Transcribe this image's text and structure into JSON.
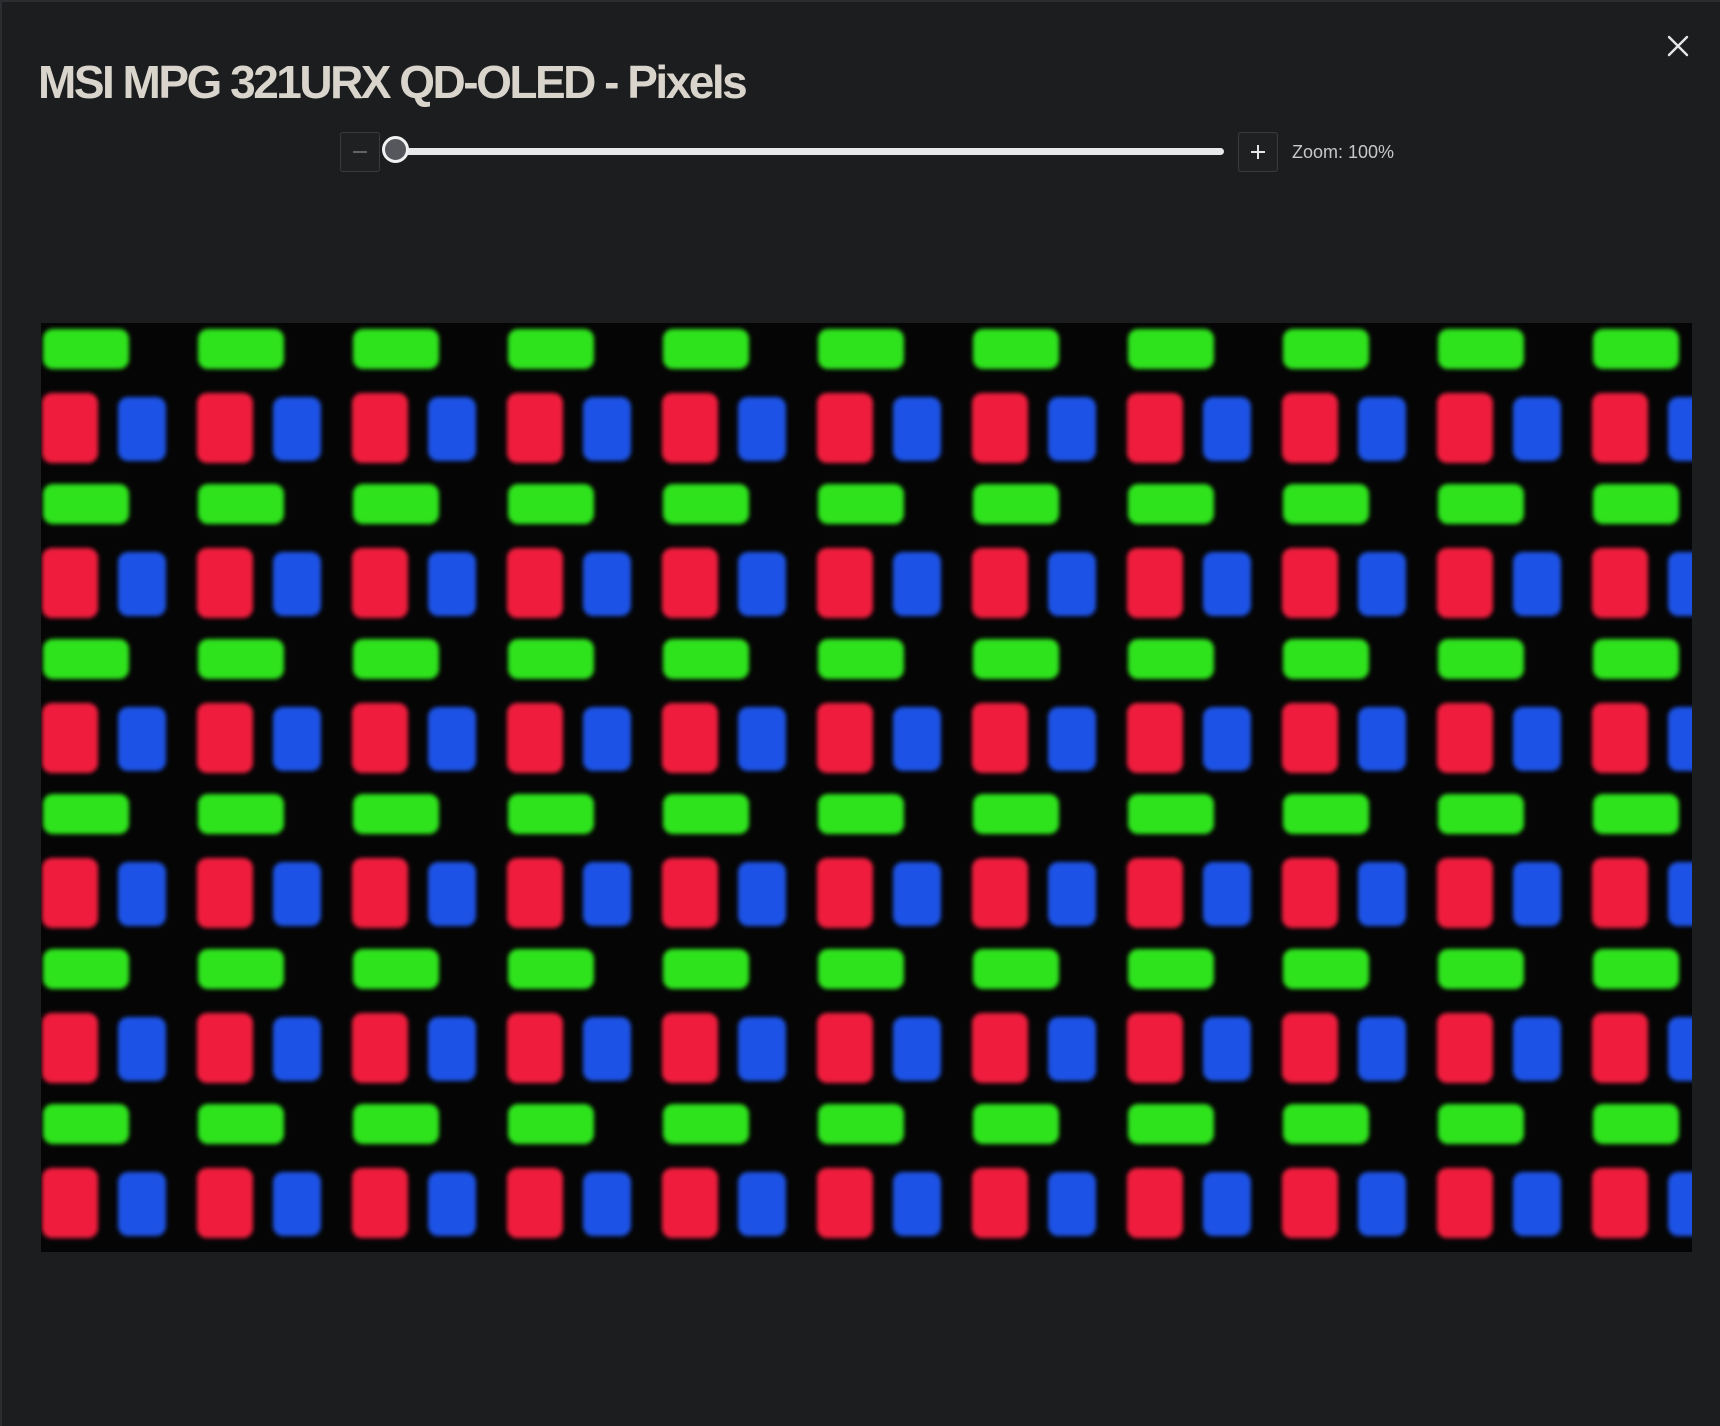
{
  "dialog": {
    "title": "MSI MPG 321URX QD-OLED - Pixels",
    "close_icon": "close-icon"
  },
  "zoom": {
    "label": "Zoom: 100%",
    "value_percent": 100,
    "slider_position": 0,
    "zoom_out_icon": "minus-icon",
    "zoom_in_icon": "plus-icon"
  },
  "image": {
    "subject": "subpixel-macro-photo",
    "colors": {
      "green": "#2fe31c",
      "red": "#f01e3c",
      "blue": "#1f52e6",
      "background": "#050505"
    }
  },
  "colors": {
    "dialog_background": "#1c1d1f",
    "title_text": "#d9d4cc",
    "slider_track": "#e8e8e8",
    "slider_thumb": "#55575c"
  }
}
